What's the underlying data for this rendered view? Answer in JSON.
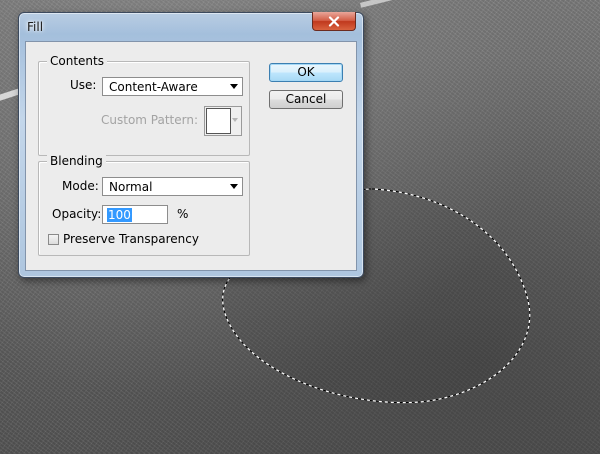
{
  "window": {
    "title": "Fill",
    "close_icon": "close-icon"
  },
  "contents": {
    "label": "Contents",
    "use_label": "Use:",
    "use_value": "Content-Aware",
    "custom_pattern_label": "Custom Pattern:",
    "custom_pattern_enabled": false
  },
  "blending": {
    "label": "Blending",
    "mode_label": "Mode:",
    "mode_value": "Normal",
    "opacity_label": "Opacity:",
    "opacity_value": "100",
    "opacity_unit": "%",
    "preserve_label": "Preserve Transparency",
    "preserve_checked": false
  },
  "buttons": {
    "ok": "OK",
    "cancel": "Cancel"
  }
}
